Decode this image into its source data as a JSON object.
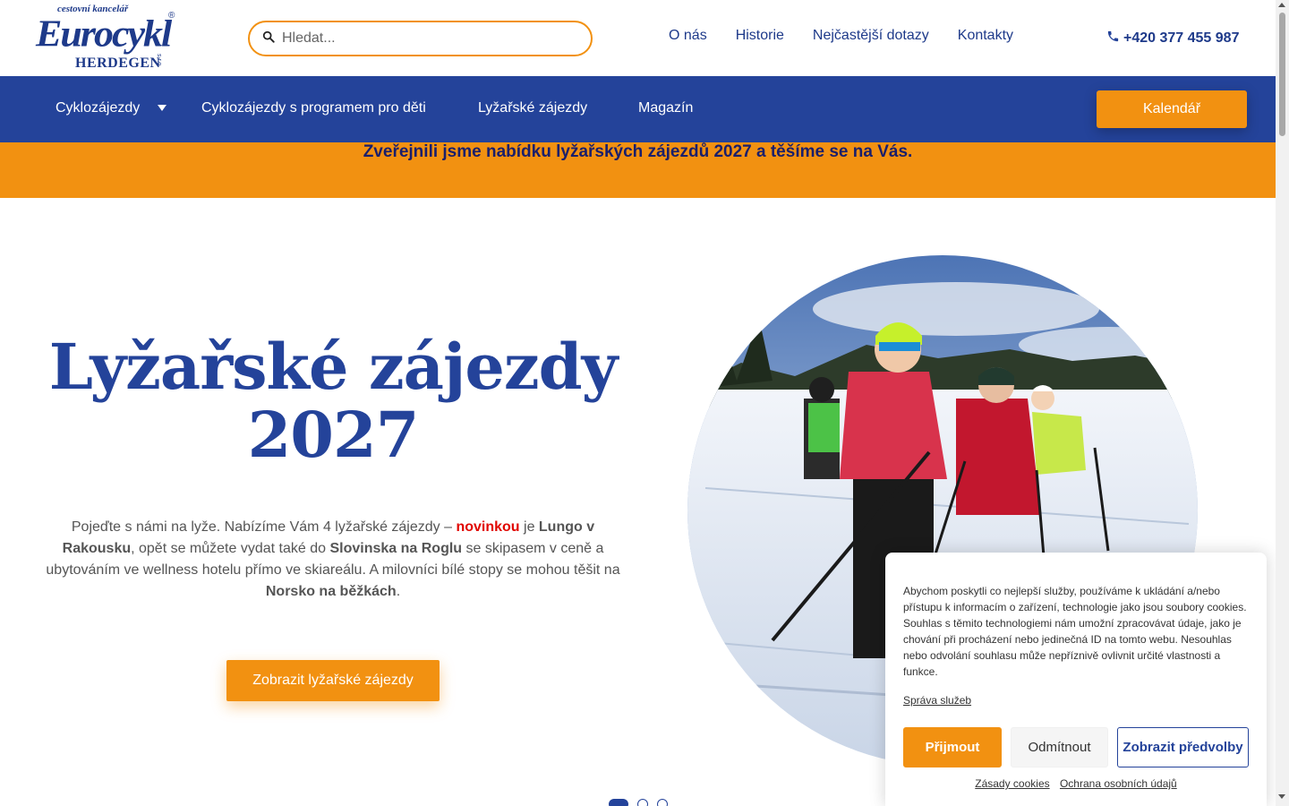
{
  "header": {
    "logo": {
      "tagline": "cestovní kancelář",
      "brand": "Eurocykl",
      "sub": "HERDEGEN",
      "sro": "s.r.o.",
      "reg": "®"
    },
    "search": {
      "placeholder": "Hledat..."
    },
    "links": [
      "O nás",
      "Historie",
      "Nejčastější dotazy",
      "Kontakty"
    ],
    "phone": "+420 377 455 987"
  },
  "nav": {
    "items": [
      "Cyklozájezdy",
      "Cyklozájezdy s programem pro děti",
      "Lyžařské zájezdy",
      "Magazín"
    ],
    "calendar": "Kalendář"
  },
  "banner": {
    "text": "Zveřejnili jsme nabídku lyžařských zájezdů 2027 a těšíme se na Vás."
  },
  "hero": {
    "title_line1": "Lyžařské zájezdy",
    "title_line2": "2027",
    "text": {
      "p1": "Pojeďte s námi na lyže. Nabízíme Vám 4 lyžařské zájezdy – ",
      "highlight": "novinkou",
      "p2": " je ",
      "b1": "Lungo v Rakousku",
      "p3": ", opět se můžete vydat také do ",
      "b2": "Slovinska na Roglu",
      "p4": " se skipasem v ceně a ubytováním ve wellness hotelu přímo ve skiareálu. A milovníci bílé stopy se mohou těšit na ",
      "b3": "Norsko na běžkách",
      "p5": "."
    },
    "button": "Zobrazit lyžařské zájezdy",
    "slides_total": 3,
    "slide_active": 1
  },
  "cookie": {
    "text": "Abychom poskytli co nejlepší služby, používáme k ukládání a/nebo přístupu k informacím o zařízení, technologie jako jsou soubory cookies. Souhlas s těmito technologiemi nám umožní zpracovávat údaje, jako je chování při procházení nebo jedinečná ID na tomto webu. Nesouhlas nebo odvolání souhlasu může nepříznivě ovlivnit určité vlastnosti a funkce.",
    "manage": "Správa služeb",
    "accept": "Přijmout",
    "deny": "Odmítnout",
    "prefs": "Zobrazit předvolby",
    "policy_links": [
      "Zásady cookies",
      "Ochrana osobních údajů"
    ]
  },
  "colors": {
    "primary": "#24439a",
    "accent": "#f29111",
    "banner_text": "#1a1f6b",
    "highlight_red": "#e10600"
  }
}
